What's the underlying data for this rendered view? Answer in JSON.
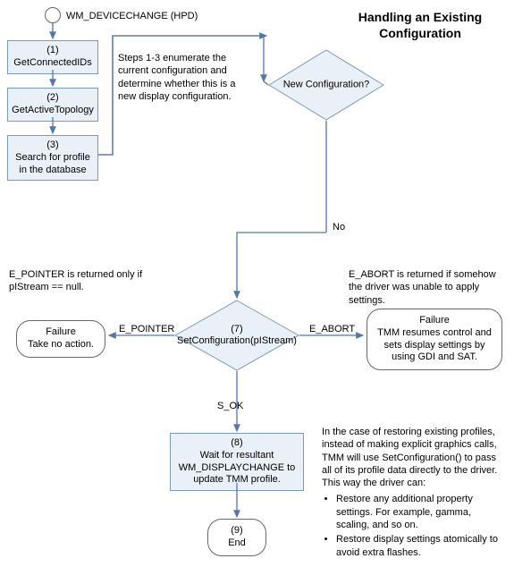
{
  "title_line1": "Handling an Existing",
  "title_line2": "Configuration",
  "start_event": "WM_DEVICECHANGE (HPD)",
  "steps": {
    "s1_num": "(1)",
    "s1_label": "GetConnectedIDs",
    "s2_num": "(2)",
    "s2_label": "GetActiveTopology",
    "s3_num": "(3)",
    "s3_label": "Search for profile in the database",
    "s8_num": "(8)",
    "s8_label": "Wait for resultant WM_DISPLAYCHANGE to update TMM profile."
  },
  "decisions": {
    "d_newconfig": "New Configuration?",
    "d7_num": "(7)",
    "d7_label": "SetConfiguration(pIStream)"
  },
  "terminators": {
    "fail_left_title": "Failure",
    "fail_left_text": "Take no action.",
    "fail_right_title": "Failure",
    "fail_right_text": "TMM resumes control and sets display settings by using GDI and SAT.",
    "end_num": "(9)",
    "end_label": "End"
  },
  "edges": {
    "no": "No",
    "e_pointer": "E_POINTER",
    "e_abort": "E_ABORT",
    "s_ok": "S_OK"
  },
  "notes": {
    "steps13": "Steps 1-3 enumerate the current configuration and determine whether this is a new display configuration.",
    "epointer": "E_POINTER is returned only if pIStream == null.",
    "eabort": "E_ABORT is returned if somehow the driver was unable to apply settings.",
    "restore_intro": "In the case of restoring existing profiles, instead of making explicit graphics calls, TMM will use SetConfiguration() to pass all of its profile data directly to the driver. This way the driver can:",
    "restore_b1": "Restore any additional property settings. For example, gamma, scaling, and so on.",
    "restore_b2": "Restore display settings atomically to avoid extra flashes."
  }
}
